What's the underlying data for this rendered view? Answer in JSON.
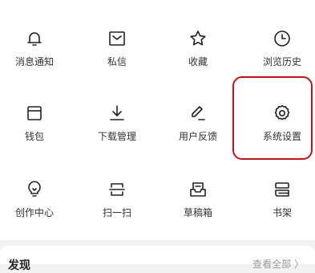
{
  "menu": {
    "row1": [
      {
        "label": "消息通知",
        "icon": "bell-icon"
      },
      {
        "label": "私信",
        "icon": "mail-icon"
      },
      {
        "label": "收藏",
        "icon": "star-icon"
      },
      {
        "label": "浏览历史",
        "icon": "clock-icon"
      }
    ],
    "row2": [
      {
        "label": "钱包",
        "icon": "wallet-icon"
      },
      {
        "label": "下载管理",
        "icon": "download-icon"
      },
      {
        "label": "用户反馈",
        "icon": "pen-icon"
      },
      {
        "label": "系统设置",
        "icon": "gear-icon"
      }
    ],
    "row3": [
      {
        "label": "创作中心",
        "icon": "lightbulb-icon"
      },
      {
        "label": "扫一扫",
        "icon": "scan-icon"
      },
      {
        "label": "草稿箱",
        "icon": "draft-tray-icon"
      },
      {
        "label": "书架",
        "icon": "bookshelf-icon"
      }
    ]
  },
  "highlight_color": "#c0151f",
  "section": {
    "title": "发现",
    "see_all": "查看全部 〉"
  }
}
